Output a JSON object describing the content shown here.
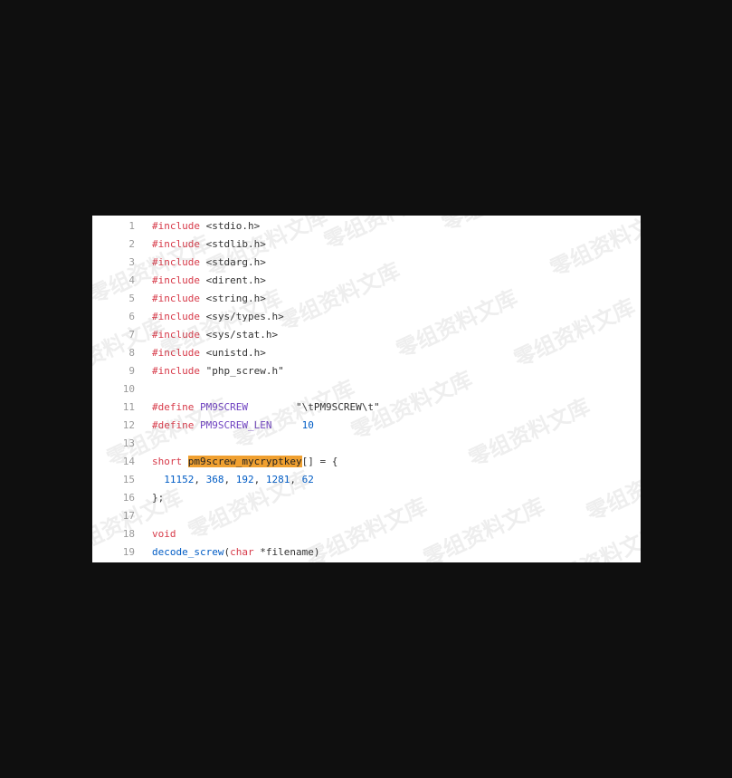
{
  "lines": [
    {
      "n": "1",
      "parts": [
        {
          "t": "#include",
          "c": "kw"
        },
        {
          "t": " <stdio.h>",
          "c": ""
        }
      ]
    },
    {
      "n": "2",
      "parts": [
        {
          "t": "#include",
          "c": "kw"
        },
        {
          "t": " <stdlib.h>",
          "c": ""
        }
      ]
    },
    {
      "n": "3",
      "parts": [
        {
          "t": "#include",
          "c": "kw"
        },
        {
          "t": " <stdarg.h>",
          "c": ""
        }
      ]
    },
    {
      "n": "4",
      "parts": [
        {
          "t": "#include",
          "c": "kw"
        },
        {
          "t": " <dirent.h>",
          "c": ""
        }
      ]
    },
    {
      "n": "5",
      "parts": [
        {
          "t": "#include",
          "c": "kw"
        },
        {
          "t": " <string.h>",
          "c": ""
        }
      ]
    },
    {
      "n": "6",
      "parts": [
        {
          "t": "#include",
          "c": "kw"
        },
        {
          "t": " <sys/types.h>",
          "c": ""
        }
      ]
    },
    {
      "n": "7",
      "parts": [
        {
          "t": "#include",
          "c": "kw"
        },
        {
          "t": " <sys/stat.h>",
          "c": ""
        }
      ]
    },
    {
      "n": "8",
      "parts": [
        {
          "t": "#include",
          "c": "kw"
        },
        {
          "t": " <unistd.h>",
          "c": ""
        }
      ]
    },
    {
      "n": "9",
      "parts": [
        {
          "t": "#include",
          "c": "kw"
        },
        {
          "t": " \"php_screw.h\"",
          "c": ""
        }
      ]
    },
    {
      "n": "10",
      "parts": []
    },
    {
      "n": "11",
      "parts": [
        {
          "t": "#define",
          "c": "kw"
        },
        {
          "t": " ",
          "c": ""
        },
        {
          "t": "PM9SCREW",
          "c": "mac"
        },
        {
          "t": "        \"\\tPM9SCREW\\t\"",
          "c": ""
        }
      ]
    },
    {
      "n": "12",
      "parts": [
        {
          "t": "#define",
          "c": "kw"
        },
        {
          "t": " ",
          "c": ""
        },
        {
          "t": "PM9SCREW_LEN",
          "c": "mac"
        },
        {
          "t": "     ",
          "c": ""
        },
        {
          "t": "10",
          "c": "num"
        }
      ]
    },
    {
      "n": "13",
      "parts": []
    },
    {
      "n": "14",
      "parts": [
        {
          "t": "short",
          "c": "kw"
        },
        {
          "t": " ",
          "c": ""
        },
        {
          "t": "pm9screw_mycryptkey",
          "c": "hl"
        },
        {
          "t": "[] = {",
          "c": ""
        }
      ]
    },
    {
      "n": "15",
      "parts": [
        {
          "t": "  ",
          "c": ""
        },
        {
          "t": "11152",
          "c": "num"
        },
        {
          "t": ", ",
          "c": ""
        },
        {
          "t": "368",
          "c": "num"
        },
        {
          "t": ", ",
          "c": ""
        },
        {
          "t": "192",
          "c": "num"
        },
        {
          "t": ", ",
          "c": ""
        },
        {
          "t": "1281",
          "c": "num"
        },
        {
          "t": ", ",
          "c": ""
        },
        {
          "t": "62",
          "c": "num"
        }
      ]
    },
    {
      "n": "16",
      "parts": [
        {
          "t": "};",
          "c": ""
        }
      ]
    },
    {
      "n": "17",
      "parts": []
    },
    {
      "n": "18",
      "parts": [
        {
          "t": "void",
          "c": "kw"
        }
      ]
    },
    {
      "n": "19",
      "parts": [
        {
          "t": "decode_screw",
          "c": "fn"
        },
        {
          "t": "(",
          "c": ""
        },
        {
          "t": "char",
          "c": "kw"
        },
        {
          "t": " *filename)",
          "c": ""
        }
      ]
    }
  ],
  "watermark_text": "零组资料文库"
}
